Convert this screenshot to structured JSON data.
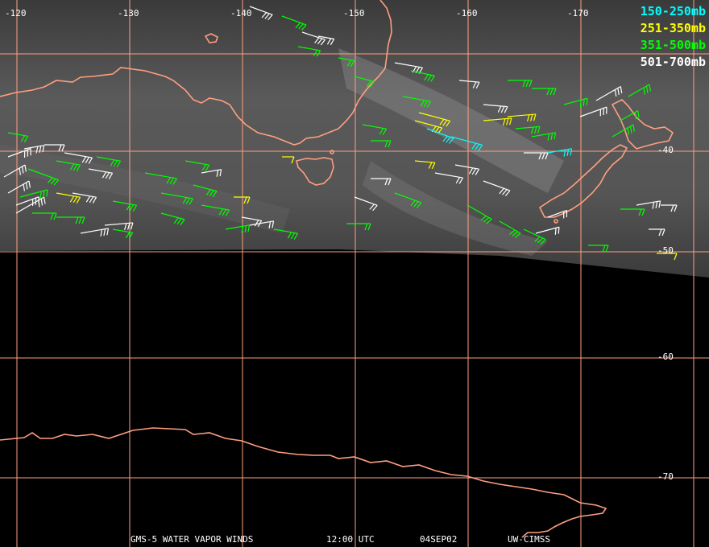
{
  "legend": [
    {
      "label": "150-250mb",
      "color": "#00ffff"
    },
    {
      "label": "251-350mb",
      "color": "#ffff00"
    },
    {
      "label": "351-500mb",
      "color": "#00ff00"
    },
    {
      "label": "501-700mb",
      "color": "#ffffff"
    }
  ],
  "longitude_labels": [
    "-120",
    "-130",
    "-140",
    "-150",
    "-160",
    "-170"
  ],
  "latitude_labels": [
    "-40",
    "-50",
    "-60",
    "-70"
  ],
  "footer": {
    "product": "GMS-5 WATER VAPOR WINDS",
    "time": "12:00 UTC",
    "date": "04SEP02",
    "credit": "UW-CIMSS"
  },
  "colors": {
    "coastline": "#ff9f80",
    "gridline": "#ffa080",
    "background": "#000000"
  }
}
